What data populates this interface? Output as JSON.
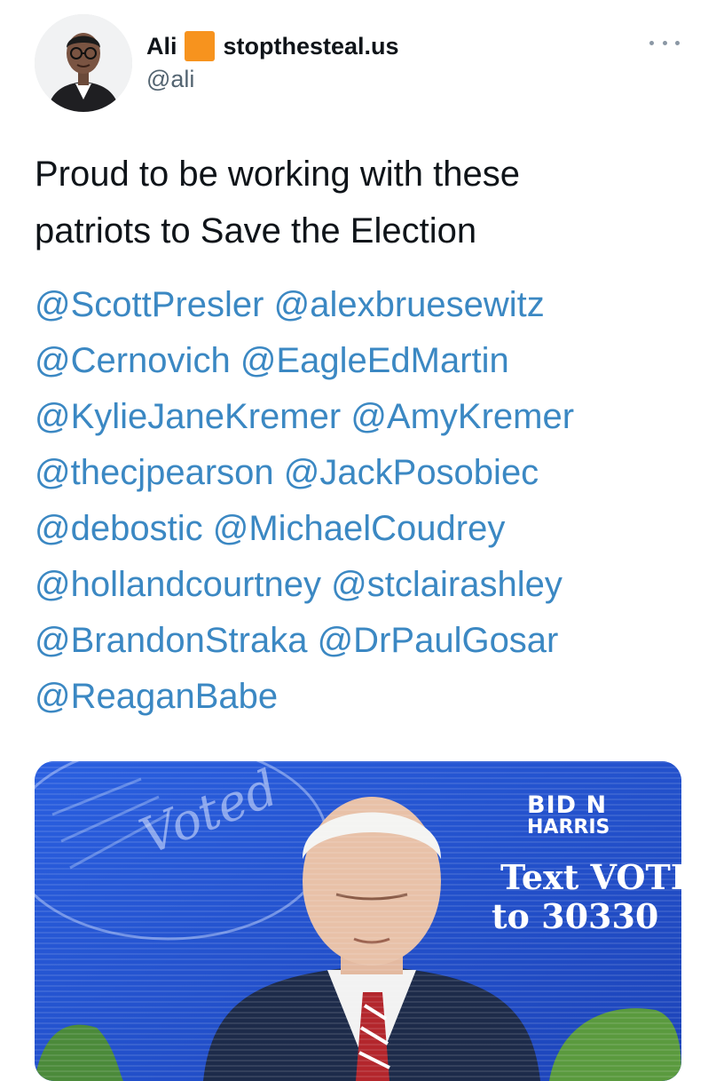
{
  "author": {
    "display_name": "Ali",
    "flag_icon": "orange-square-icon",
    "site_label": "stopthesteal.us",
    "handle": "@ali"
  },
  "menu": {
    "icon": "more-horizontal-icon"
  },
  "tweet": {
    "text_line1": "Proud to be working with these",
    "text_line2": "patriots to Save the Election",
    "mention_lines": [
      [
        "@ScottPresler",
        "@alexbruesewitz"
      ],
      [
        "@Cernovich",
        "@EagleEdMartin"
      ],
      [
        "@KylieJaneKremer",
        "@AmyKremer"
      ],
      [
        "@thecjpearson",
        "@JackPosobiec"
      ],
      [
        "@debostic",
        "@MichaelCoudrey"
      ],
      [
        "@hollandcourtney",
        "@stclairashley"
      ],
      [
        "@BrandonStraka",
        "@DrPaulGosar"
      ],
      [
        "@ReaganBabe"
      ]
    ]
  },
  "media": {
    "sticker_text": "Voted",
    "brand_name": "BID N",
    "brand_sub": "HARRIS",
    "cta_line1": "Text VOTE",
    "cta_line2": "to 30330"
  },
  "colors": {
    "mention": "#3b88c3",
    "flag": "#f7931e",
    "media_background": "#1d4fd0"
  }
}
